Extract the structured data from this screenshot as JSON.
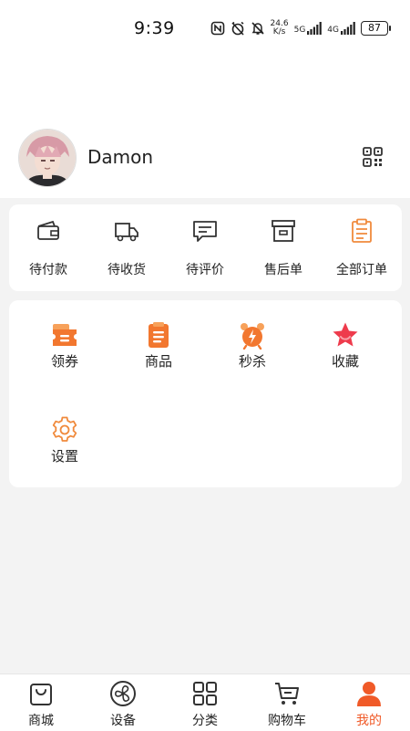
{
  "status_bar": {
    "time": "9:39",
    "net_speed_value": "24.6",
    "net_speed_unit": "K/s",
    "signal_5g": "5G",
    "signal_4g": "4G",
    "battery": "87"
  },
  "profile": {
    "username": "Damon"
  },
  "orders": [
    {
      "label": "待付款",
      "icon": "wallet-icon"
    },
    {
      "label": "待收货",
      "icon": "truck-icon"
    },
    {
      "label": "待评价",
      "icon": "comment-icon"
    },
    {
      "label": "售后单",
      "icon": "archive-box-icon"
    },
    {
      "label": "全部订单",
      "icon": "clipboard-icon"
    }
  ],
  "tools": [
    {
      "label": "领券",
      "icon": "coupon-icon"
    },
    {
      "label": "商品",
      "icon": "product-list-icon"
    },
    {
      "label": "秒杀",
      "icon": "alarm-clock-icon"
    },
    {
      "label": "收藏",
      "icon": "star-icon"
    },
    {
      "label": "设置",
      "icon": "gear-icon"
    }
  ],
  "tabbar": {
    "items": [
      {
        "label": "商城",
        "icon": "shopping-bag-icon"
      },
      {
        "label": "设备",
        "icon": "fan-icon"
      },
      {
        "label": "分类",
        "icon": "grid-icon"
      },
      {
        "label": "购物车",
        "icon": "cart-icon"
      },
      {
        "label": "我的",
        "icon": "user-icon"
      }
    ],
    "active": "我的"
  },
  "colors": {
    "accent": "#f05a28",
    "icon_orange": "#f08a3c",
    "background": "#f3f3f3",
    "card": "#ffffff"
  }
}
